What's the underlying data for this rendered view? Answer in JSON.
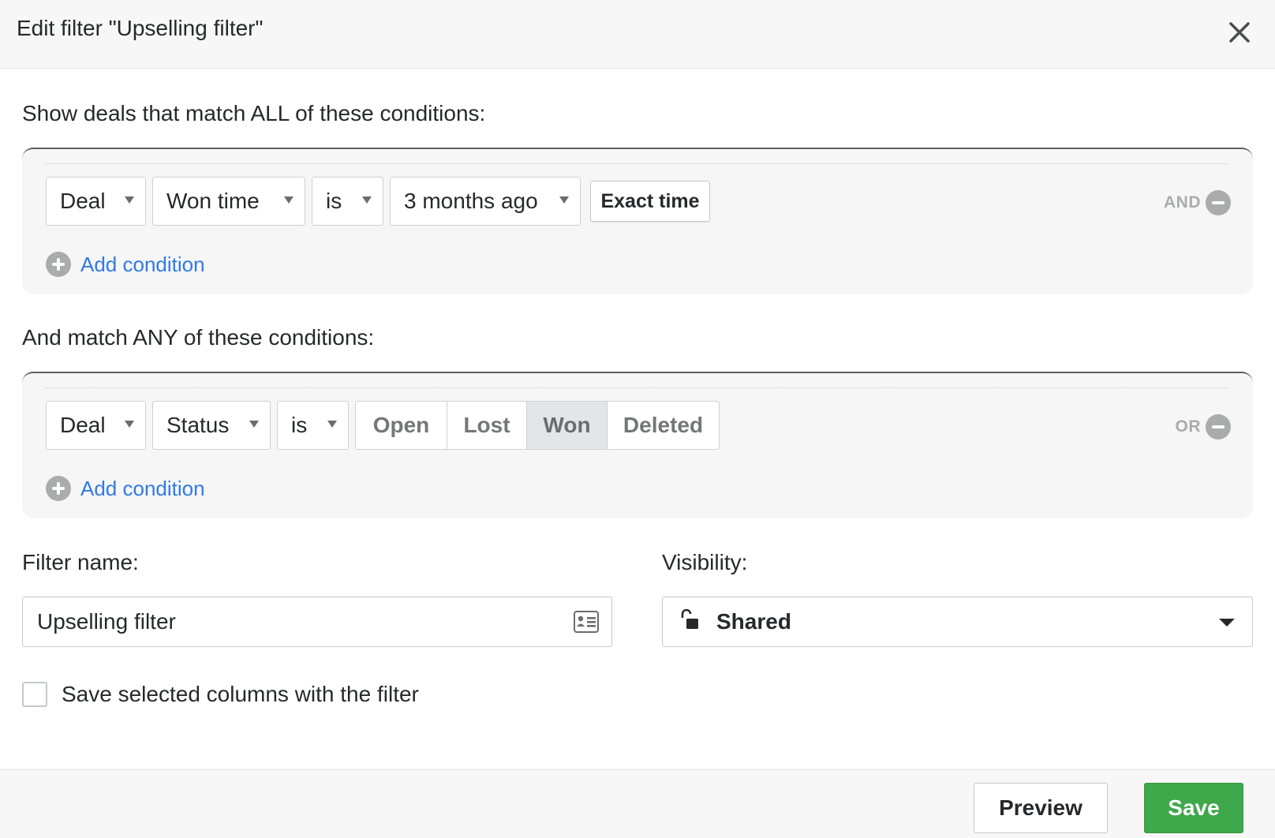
{
  "dialog": {
    "title": "Edit filter \"Upselling filter\""
  },
  "all_section": {
    "heading": "Show deals that match ALL of these conditions:",
    "condition": {
      "object": "Deal",
      "field": "Won time",
      "operator": "is",
      "value": "3 months ago",
      "extra_button": "Exact time"
    },
    "logic_label": "AND",
    "add_condition": "Add condition"
  },
  "any_section": {
    "heading": "And match ANY of these conditions:",
    "condition": {
      "object": "Deal",
      "field": "Status",
      "operator": "is",
      "options": [
        "Open",
        "Lost",
        "Won",
        "Deleted"
      ],
      "selected": "Won"
    },
    "logic_label": "OR",
    "add_condition": "Add condition"
  },
  "filter_name": {
    "label": "Filter name:",
    "value": "Upselling filter"
  },
  "visibility": {
    "label": "Visibility:",
    "value": "Shared"
  },
  "save_columns": {
    "label": "Save selected columns with the filter",
    "checked": false
  },
  "footer": {
    "preview_label": "Preview",
    "save_label": "Save"
  },
  "colors": {
    "link": "#317ae2",
    "save_button": "#3ea84b",
    "panel_bg": "#f6f6f6"
  }
}
